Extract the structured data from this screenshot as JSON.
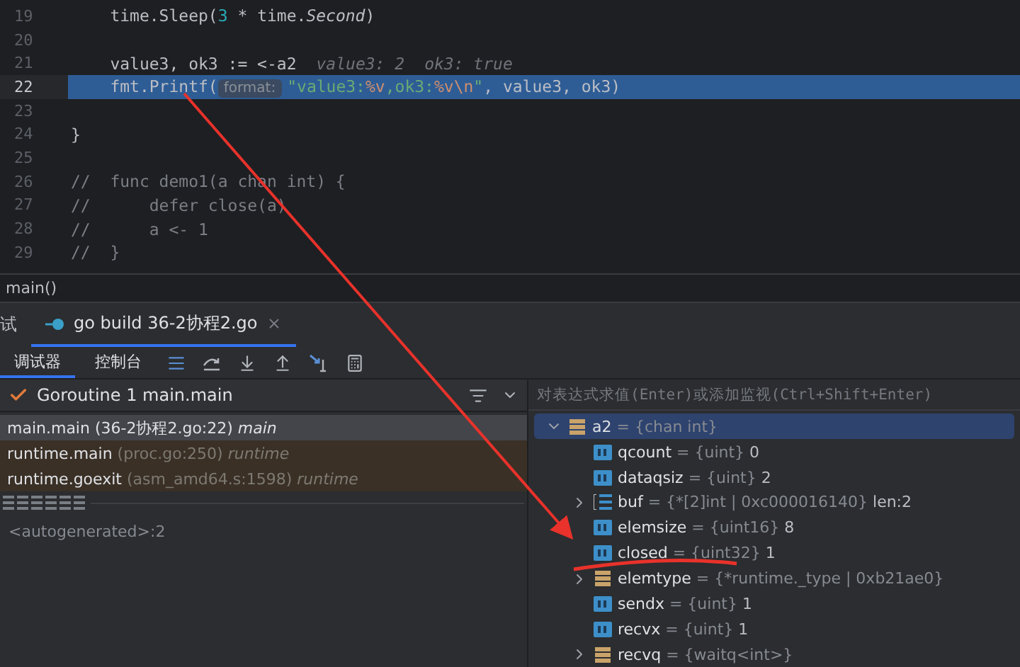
{
  "editor": {
    "lines": [
      {
        "number": "19",
        "current": false,
        "tokens": [
          {
            "kind": "plain",
            "text": "    time.Sleep("
          },
          {
            "kind": "num",
            "text": "3"
          },
          {
            "kind": "plain",
            "text": " * time."
          },
          {
            "kind": "italic",
            "text": "Second"
          },
          {
            "kind": "plain",
            "text": ")"
          }
        ]
      },
      {
        "number": "20",
        "current": false
      },
      {
        "number": "21",
        "current": false,
        "tokens": [
          {
            "kind": "plain",
            "text": "    value3, ok3 := <-a2"
          }
        ],
        "inline_values": [
          "value3: 2",
          "ok3: true"
        ]
      },
      {
        "number": "22",
        "current": true,
        "tokens": [
          {
            "kind": "plain",
            "text": "    fmt.Printf("
          },
          {
            "kind": "hint",
            "text": "format:"
          },
          {
            "kind": "str",
            "text": "\"value3:"
          },
          {
            "kind": "escape",
            "text": "%v"
          },
          {
            "kind": "str",
            "text": ",ok3:"
          },
          {
            "kind": "escape",
            "text": "%v\\n"
          },
          {
            "kind": "str",
            "text": "\""
          },
          {
            "kind": "plain",
            "text": ", value3, ok3)"
          }
        ]
      },
      {
        "number": "23",
        "current": false
      },
      {
        "number": "24",
        "current": false,
        "tokens": [
          {
            "kind": "plain",
            "text": "}"
          }
        ]
      },
      {
        "number": "25",
        "current": false
      },
      {
        "number": "26",
        "current": false,
        "tokens": [
          {
            "kind": "comment",
            "text": "//  func demo1(a chan int) {"
          }
        ]
      },
      {
        "number": "27",
        "current": false,
        "tokens": [
          {
            "kind": "comment",
            "text": "//      defer close(a)"
          }
        ]
      },
      {
        "number": "28",
        "current": false,
        "tokens": [
          {
            "kind": "comment",
            "text": "//      a <- 1"
          }
        ]
      },
      {
        "number": "29",
        "current": false,
        "tokens": [
          {
            "kind": "comment",
            "text": "//  }"
          }
        ]
      }
    ],
    "breadcrumb": "main()"
  },
  "tool_window": {
    "title_fragment": "试",
    "tabs": [
      {
        "label": "go build 36-2协程2.go",
        "selected": true
      }
    ],
    "subtabs": [
      {
        "label": "调试器",
        "selected": true
      },
      {
        "label": "控制台",
        "selected": false
      }
    ]
  },
  "frames": {
    "goroutine": "Goroutine 1 main.main",
    "items": [
      {
        "function": "main.main",
        "location": "(36-2协程2.go:22)",
        "package": "main",
        "selected": true,
        "kind": "user"
      },
      {
        "function": "runtime.main",
        "location": "(proc.go:250)",
        "package": "runtime",
        "selected": false,
        "kind": "library"
      },
      {
        "function": "runtime.goexit",
        "location": "(asm_amd64.s:1598)",
        "package": "runtime",
        "selected": false,
        "kind": "library"
      }
    ],
    "extra": "<autogenerated>:2"
  },
  "variables": {
    "placeholder": "对表达式求值(Enter)或添加监视(Ctrl+Shift+Enter)",
    "root": {
      "name": "a2",
      "type": "= {chan int}",
      "kind": "struct",
      "expanded": true,
      "selected": true,
      "children": [
        {
          "name": "qcount",
          "type": "= {uint}",
          "value": "0",
          "kind": "field"
        },
        {
          "name": "dataqsiz",
          "type": "= {uint}",
          "value": "2",
          "kind": "field"
        },
        {
          "name": "buf",
          "type": "= {*[2]int | 0xc000016140}",
          "value": "len:2",
          "kind": "array",
          "expanded": false
        },
        {
          "name": "elemsize",
          "type": "= {uint16}",
          "value": "8",
          "kind": "field"
        },
        {
          "name": "closed",
          "type": "= {uint32}",
          "value": "1",
          "kind": "field"
        },
        {
          "name": "elemtype",
          "type": "= {*runtime._type | 0xb21ae0}",
          "kind": "struct",
          "expanded": false
        },
        {
          "name": "sendx",
          "type": "= {uint}",
          "value": "1",
          "kind": "field"
        },
        {
          "name": "recvx",
          "type": "= {uint}",
          "value": "1",
          "kind": "field"
        },
        {
          "name": "recvq",
          "type": "= {waitq<int>}",
          "kind": "struct",
          "expanded": false
        }
      ]
    }
  }
}
